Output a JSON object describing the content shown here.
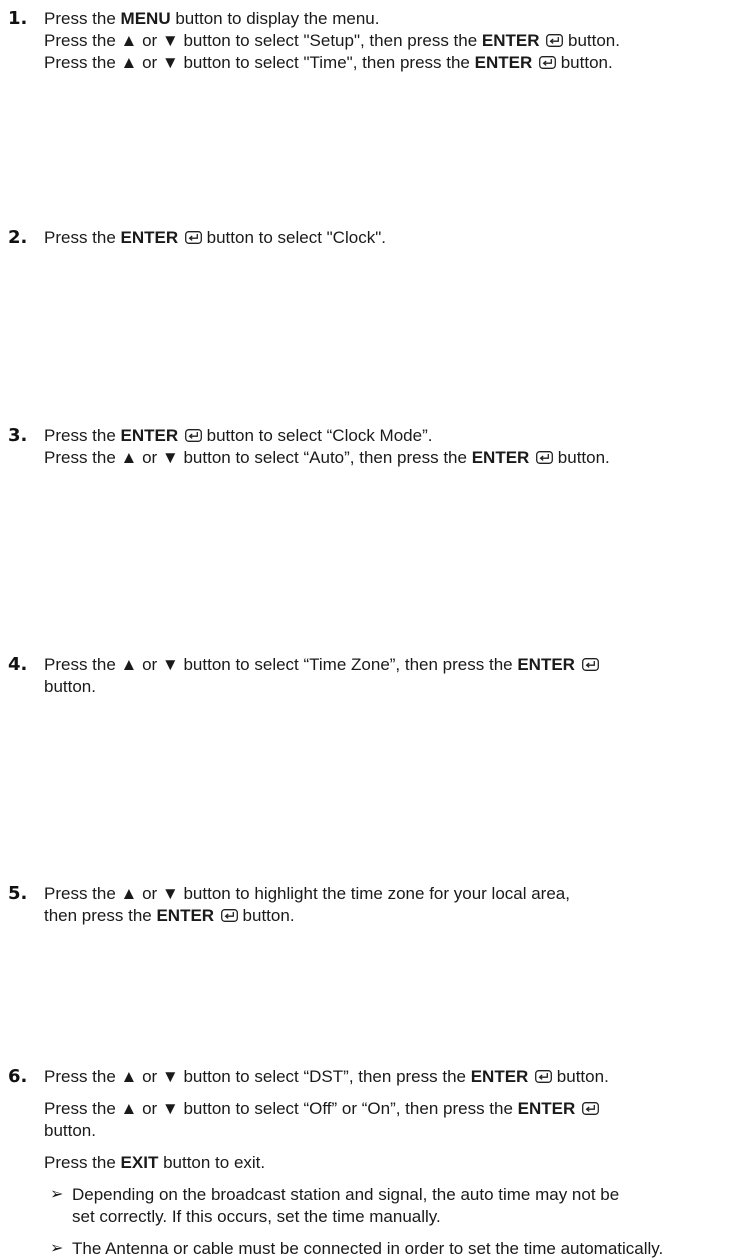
{
  "steps": [
    {
      "number": "1.",
      "lines": [
        {
          "a": "Press the ",
          "b": "MENU",
          "c": " button to display the menu."
        },
        {
          "a": "Press the ▲ or ▼ button to select \"Setup\", then press the ",
          "b": "ENTER",
          "c": " button."
        },
        {
          "a": "Press the ▲ or ▼ button to select \"Time\", then press the ",
          "b": "ENTER",
          "c": " button."
        }
      ]
    },
    {
      "number": "2.",
      "lines": [
        {
          "a": "Press the ",
          "b": "ENTER",
          "c": " button to select \"Clock\"."
        }
      ]
    },
    {
      "number": "3.",
      "lines": [
        {
          "a": "Press the ",
          "b": "ENTER",
          "c": " button to select “Clock Mode”."
        },
        {
          "a": "Press the ▲ or ▼ button to select “Auto”, then press the ",
          "b": "ENTER",
          "c": " button."
        }
      ]
    },
    {
      "number": "4.",
      "lines": [
        {
          "a": "Press the ▲ or ▼ button to select “Time Zone”, then press the ",
          "b": "ENTER",
          "c": ""
        },
        {
          "a": "button."
        }
      ]
    },
    {
      "number": "5.",
      "lines": [
        {
          "a": "Press the ▲ or ▼ button to highlight the time zone for your local area,"
        },
        {
          "a": "then press the ",
          "b": "ENTER",
          "c": " button."
        }
      ]
    },
    {
      "number": "6.",
      "lines": [
        {
          "a": "Press the ▲ or ▼ button to select “DST”, then press the ",
          "b": "ENTER",
          "c": " button."
        },
        {
          "a": "Press the ▲ or ▼ button to select “Off” or “On”, then press the ",
          "b": "ENTER",
          "c": ""
        },
        {
          "a": "button."
        },
        {
          "a": "Press the ",
          "b": "EXIT",
          "c": " button to exit."
        }
      ],
      "notes": [
        {
          "line1": "Depending on the broadcast station and signal, the auto time may not be",
          "line2": "set correctly. If this occurs, set the time manually."
        },
        {
          "line1": "The Antenna or cable must be connected in order to set the time automatically."
        }
      ]
    }
  ],
  "note_arrow": "➢",
  "icons": {
    "enter": "enter-icon"
  }
}
